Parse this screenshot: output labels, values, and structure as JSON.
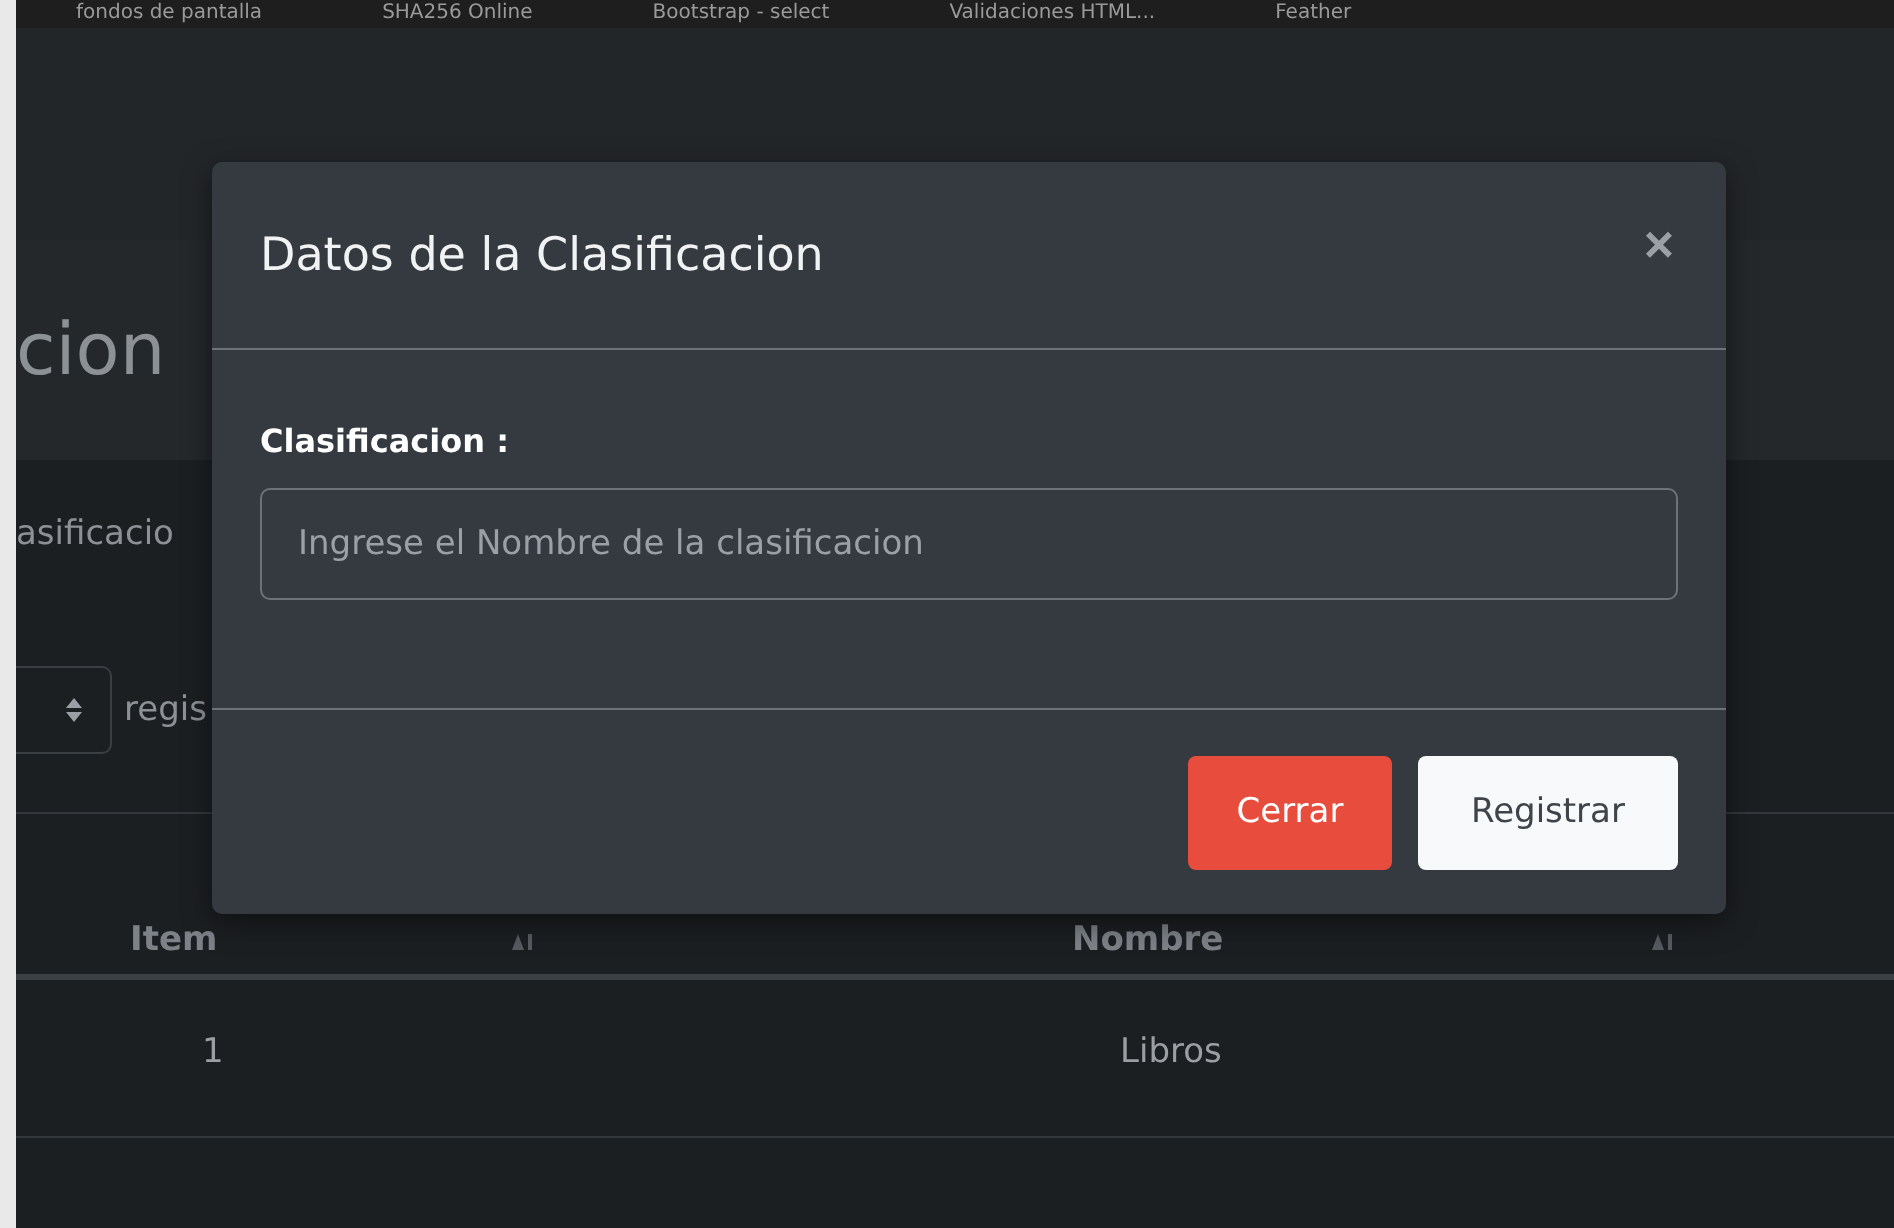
{
  "bookmarks": [
    "fondos de pantalla",
    "SHA256 Online",
    "Bootstrap - select",
    "Validaciones HTML...",
    "Feather"
  ],
  "page": {
    "title": "cion",
    "subtitle": "asificacio",
    "length_suffix": "regis"
  },
  "table": {
    "columns": [
      "Item",
      "Nombre"
    ],
    "rows": [
      {
        "cells": [
          "1",
          "Libros"
        ]
      }
    ]
  },
  "modal": {
    "title": "Datos de la Clasificacion",
    "close": "×",
    "label": "Clasificacion :",
    "placeholder": "Ingrese el Nombre de la clasificacion",
    "buttons": [
      {
        "label": "Cerrar",
        "kind": "danger"
      },
      {
        "label": "Registrar",
        "kind": "light"
      }
    ]
  }
}
